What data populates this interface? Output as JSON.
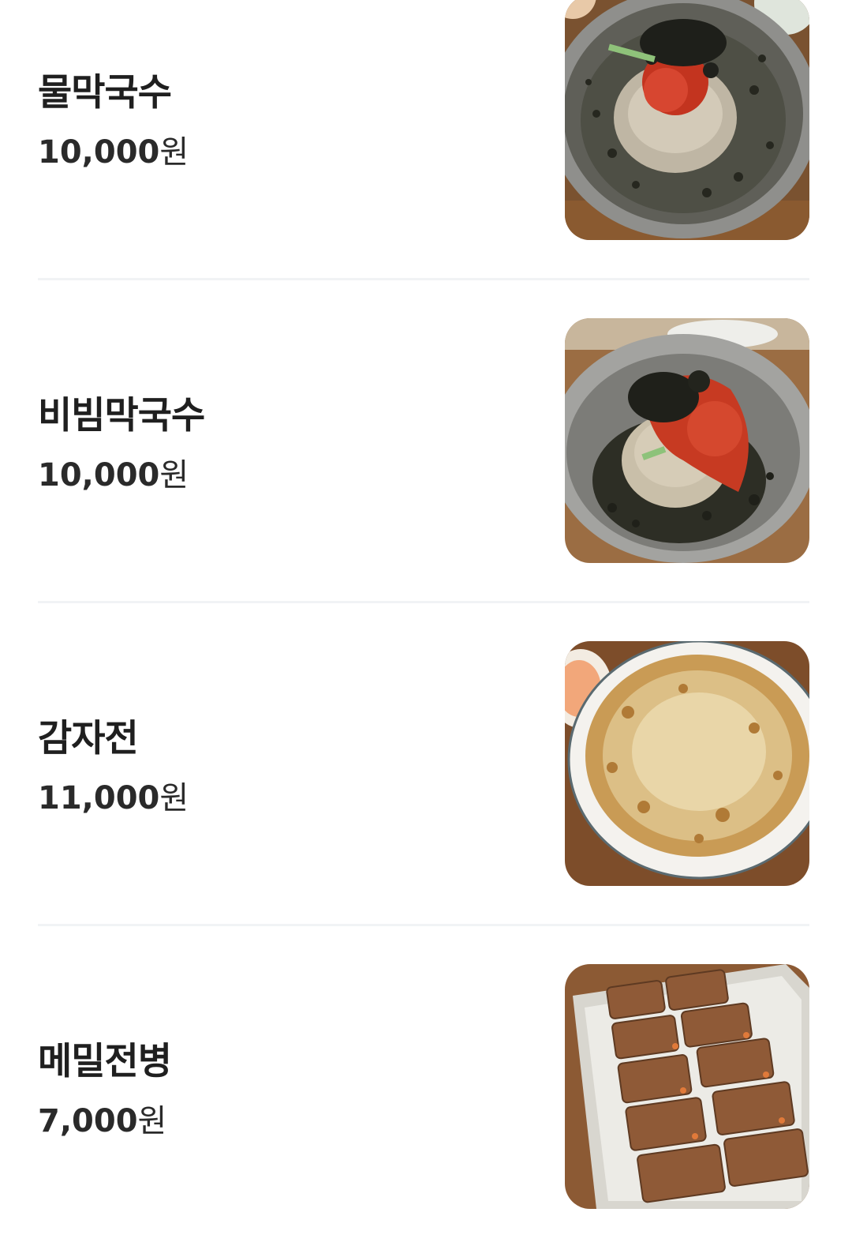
{
  "menu": {
    "items": [
      {
        "name": "물막국수",
        "price": "10,000",
        "currency": "원",
        "photo_icon": "cold-buckwheat-noodle-soup-photo"
      },
      {
        "name": "비빔막국수",
        "price": "10,000",
        "currency": "원",
        "photo_icon": "spicy-buckwheat-noodle-photo"
      },
      {
        "name": "감자전",
        "price": "11,000",
        "currency": "원",
        "photo_icon": "potato-pancake-photo"
      },
      {
        "name": "메밀전병",
        "price": "7,000",
        "currency": "원",
        "photo_icon": "buckwheat-crepe-roll-photo"
      }
    ]
  },
  "colors": {
    "background": "#ffffff",
    "text": "#1f1f1f",
    "divider": "#f1f3f5"
  }
}
